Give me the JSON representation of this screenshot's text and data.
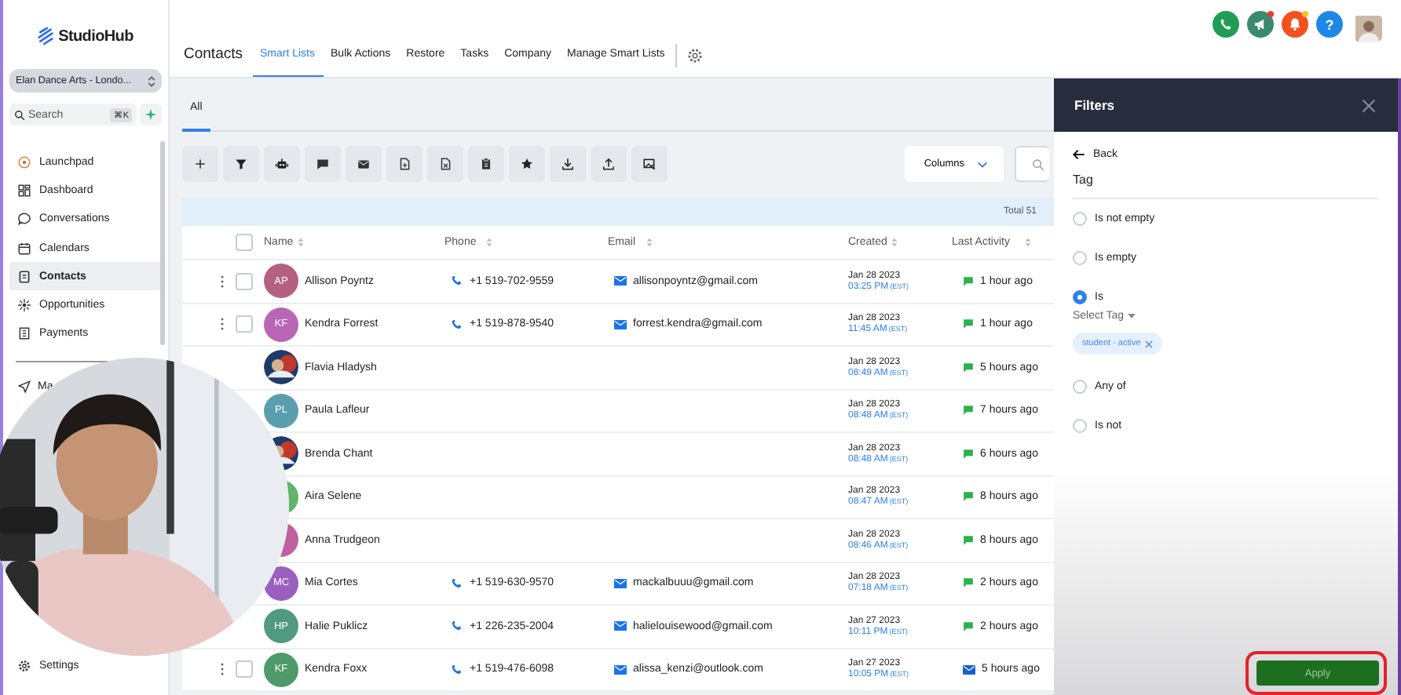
{
  "sidebar": {
    "logo": "StudioHub",
    "account": "Elan Dance Arts - Londo...",
    "search": {
      "placeholder": "Search",
      "shortcut": "⌘K"
    },
    "items": [
      {
        "label": "Launchpad",
        "selected": false
      },
      {
        "label": "Dashboard",
        "selected": false
      },
      {
        "label": "Conversations",
        "selected": false
      },
      {
        "label": "Calendars",
        "selected": false
      },
      {
        "label": "Contacts",
        "selected": true
      },
      {
        "label": "Opportunities",
        "selected": false
      },
      {
        "label": "Payments",
        "selected": false
      }
    ],
    "cut_item": {
      "label": "Ma",
      "selected": false
    },
    "settings": "Settings"
  },
  "header": {
    "title": "Contacts",
    "tabs": [
      {
        "label": "Smart Lists",
        "selected": true
      },
      {
        "label": "Bulk Actions",
        "selected": false
      },
      {
        "label": "Restore",
        "selected": false
      },
      {
        "label": "Tasks",
        "selected": false
      },
      {
        "label": "Company",
        "selected": false
      },
      {
        "label": "Manage Smart Lists",
        "selected": false
      }
    ],
    "top_icons": [
      {
        "kind": "phone",
        "color": "#1f9d55"
      },
      {
        "kind": "megaphone",
        "color": "#3b8a6e",
        "badge": {
          "color": "#e53935"
        }
      },
      {
        "kind": "bell",
        "color": "#f4511e",
        "badge": {
          "color": "#fbc02d"
        }
      },
      {
        "kind": "help",
        "color": "#1e88e5",
        "label": "?"
      },
      {
        "kind": "avatar"
      }
    ]
  },
  "list_tabs": [
    {
      "label": "All",
      "selected": true
    }
  ],
  "columns_button": "Columns",
  "total": "Total 51",
  "table": {
    "select_all": {
      "checked": false
    },
    "columns": [
      "Name",
      "Phone",
      "Email",
      "Created",
      "Last Activity"
    ],
    "rows": [
      {
        "checked": false,
        "avatar": {
          "kind": "initials",
          "initials": "AP",
          "color": "#b5607f"
        },
        "name": "Allison Poyntz",
        "phone": "+1 519-702-9559",
        "email": "allisonpoyntz@gmail.com",
        "date": "Jan 28 2023",
        "time": "03:25 PM",
        "tz": "(EST)",
        "activity": {
          "kind": "sms",
          "text": "1 hour ago"
        }
      },
      {
        "checked": false,
        "avatar": {
          "kind": "initials",
          "initials": "KF",
          "color": "#b866b5"
        },
        "name": "Kendra Forrest",
        "phone": "+1 519-878-9540",
        "email": "forrest.kendra@gmail.com",
        "date": "Jan 28 2023",
        "time": "11:45 AM",
        "tz": "(EST)",
        "activity": {
          "kind": "sms",
          "text": "1 hour ago"
        }
      },
      {
        "name": "Flavia Hladysh",
        "date": "Jan 28 2023",
        "time": "08:49 AM",
        "tz": "(EST)",
        "activity": {
          "kind": "sms",
          "text": "5 hours ago"
        }
      },
      {
        "avatar": {
          "kind": "initials",
          "initials": "PL",
          "color": "#5b9fae"
        },
        "name": "Paula Lafleur",
        "date": "Jan 28 2023",
        "time": "08:48 AM",
        "tz": "(EST)",
        "activity": {
          "kind": "sms",
          "text": "7 hours ago"
        }
      },
      {
        "name": "Brenda Chant",
        "date": "Jan 28 2023",
        "time": "08:48 AM",
        "tz": "(EST)",
        "activity": {
          "kind": "sms",
          "text": "6 hours ago"
        }
      },
      {
        "avatar": {
          "kind": "initials",
          "color": "#5db56a"
        },
        "name": "Aira Selene",
        "date": "Jan 28 2023",
        "time": "08:47 AM",
        "tz": "(EST)",
        "activity": {
          "kind": "sms",
          "text": "8 hours ago"
        }
      },
      {
        "avatar": {
          "kind": "initials",
          "color": "#c060a0"
        },
        "name": "Anna Trudgeon",
        "date": "Jan 28 2023",
        "time": "08:46 AM",
        "tz": "(EST)",
        "activity": {
          "kind": "sms",
          "text": "8 hours ago"
        }
      },
      {
        "avatar": {
          "kind": "initials",
          "initials": "MC",
          "color": "#9b5fc0"
        },
        "name": "Mia Cortes",
        "phone": "+1 519-630-9570",
        "email": "mackalbuuu@gmail.com",
        "date": "Jan 28 2023",
        "time": "07:18 AM",
        "tz": "(EST)",
        "activity": {
          "kind": "sms",
          "text": "2 hours ago"
        }
      },
      {
        "avatar": {
          "kind": "initials",
          "initials": "HP",
          "color": "#4f9a80"
        },
        "name": "Halie Puklicz",
        "phone": "+1 226-235-2004",
        "email": "halielouisewood@gmail.com",
        "date": "Jan 27 2023",
        "time": "10:11 PM",
        "tz": "(EST)",
        "activity": {
          "kind": "sms",
          "text": "2 hours ago"
        }
      },
      {
        "checked": false,
        "avatar": {
          "kind": "initials",
          "initials": "KF",
          "color": "#4f9a6a"
        },
        "name": "Kendra Foxx",
        "phone": "+1 519-476-6098",
        "email": "alissa_kenzi@outlook.com",
        "date": "Jan 27 2023",
        "time": "10:05 PM",
        "tz": "(EST)",
        "activity": {
          "kind": "email",
          "text": "5 hours ago"
        }
      }
    ]
  },
  "filters": {
    "title": "Filters",
    "back": "Back",
    "field": "Tag",
    "options": [
      {
        "label": "Is not empty",
        "selected": false
      },
      {
        "label": "Is empty",
        "selected": false
      },
      {
        "label": "Is",
        "selected": true,
        "select_label": "Select Tag",
        "tags": [
          "student - active"
        ]
      },
      {
        "label": "Any of",
        "selected": false
      },
      {
        "label": "Is not",
        "selected": false
      }
    ],
    "apply": {
      "label": "Apply",
      "highlighted": true
    }
  }
}
